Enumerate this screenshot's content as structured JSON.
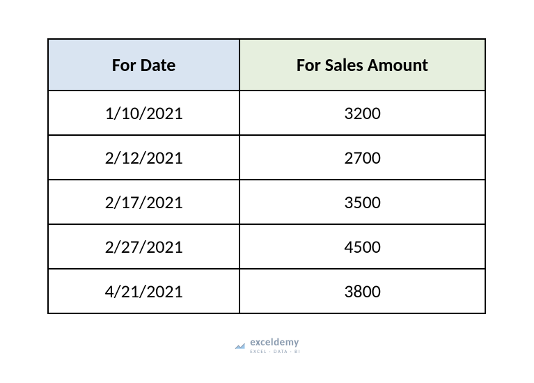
{
  "table": {
    "headers": {
      "date": "For Date",
      "sales": "For Sales Amount"
    },
    "rows": [
      {
        "date": "1/10/2021",
        "sales": "3200"
      },
      {
        "date": "2/12/2021",
        "sales": "2700"
      },
      {
        "date": "2/17/2021",
        "sales": "3500"
      },
      {
        "date": "2/27/2021",
        "sales": "4500"
      },
      {
        "date": "4/21/2021",
        "sales": "3800"
      }
    ]
  },
  "watermark": {
    "brand": "exceldemy",
    "tagline": "EXCEL · DATA · BI"
  },
  "colors": {
    "header_date_bg": "#d9e4f1",
    "header_sales_bg": "#e6efde",
    "border": "#000000",
    "watermark": "#2b4a6f"
  }
}
